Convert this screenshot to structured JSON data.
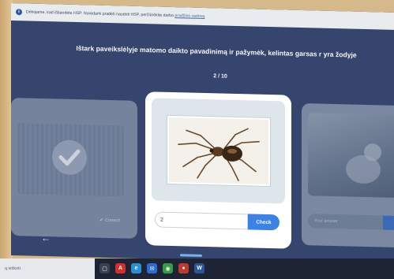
{
  "notice": {
    "icon": "info-icon",
    "text": "Dėkojame, kad išbandėte HSP. Norėdami pradėti naudoti HSP, peržiūrėkite darbo",
    "link": "pradžios vadovą"
  },
  "quiz": {
    "instruction": "Ištark paveikslėlyje matomo daikto pavadinimą ir pažymėk, kelintas garsas r yra žodyje",
    "progress": "2 / 10",
    "answer_value": "2",
    "check_label": "Check"
  },
  "prev_card": {
    "status_label": "Correct!",
    "status_icon": "checkmark-icon"
  },
  "next_card": {
    "input_placeholder": "Your answer"
  },
  "taskbar": {
    "search_text": "ą ieškoti"
  },
  "colors": {
    "screen_bg": "#36456e",
    "accent": "#3b82e6",
    "card": "#ffffff"
  }
}
